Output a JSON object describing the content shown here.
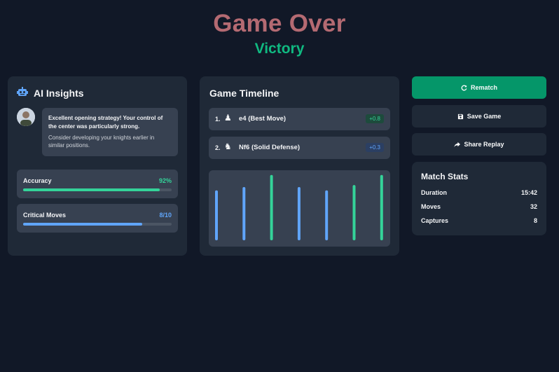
{
  "header": {
    "title": "Game Over",
    "result": "Victory"
  },
  "ai_insights": {
    "title": "AI Insights",
    "icon": "robot-icon",
    "message_primary": "Excellent opening strategy! Your control of the center was particularly strong.",
    "message_secondary": "Consider developing your knights earlier in similar positions.",
    "accuracy": {
      "label": "Accuracy",
      "value": "92%",
      "fraction": 0.92,
      "color": "#34d399"
    },
    "critical_moves": {
      "label": "Critical Moves",
      "value": "8/10",
      "fraction": 0.8,
      "color": "#60a5fa"
    }
  },
  "timeline": {
    "title": "Game Timeline",
    "moves": [
      {
        "number": "1.",
        "piece": "pawn-icon",
        "glyph": "♟",
        "name": "e4 (Best Move)",
        "badge": "+0.8",
        "badge_color": "green"
      },
      {
        "number": "2.",
        "piece": "knight-icon",
        "glyph": "♞",
        "name": "Nf6 (Solid Defense)",
        "badge": "+0.3",
        "badge_color": "blue"
      }
    ],
    "bars": [
      {
        "level": 0.7,
        "color": "#60a5fa"
      },
      {
        "level": 0.75,
        "color": "#60a5fa"
      },
      {
        "level": 0.93,
        "color": "#34d399"
      },
      {
        "level": 0.75,
        "color": "#60a5fa"
      },
      {
        "level": 0.7,
        "color": "#60a5fa"
      },
      {
        "level": 0.78,
        "color": "#34d399"
      },
      {
        "level": 0.93,
        "color": "#34d399"
      }
    ]
  },
  "actions": {
    "rematch": "Rematch",
    "save": "Save Game",
    "share": "Share Replay"
  },
  "match_stats": {
    "title": "Match Stats",
    "rows": [
      {
        "label": "Duration",
        "value": "15:42"
      },
      {
        "label": "Moves",
        "value": "32"
      },
      {
        "label": "Captures",
        "value": "8"
      }
    ]
  },
  "colors": {
    "background": "#111827",
    "card": "#1f2937",
    "accent_green": "#059669",
    "title": "#b46a72"
  }
}
